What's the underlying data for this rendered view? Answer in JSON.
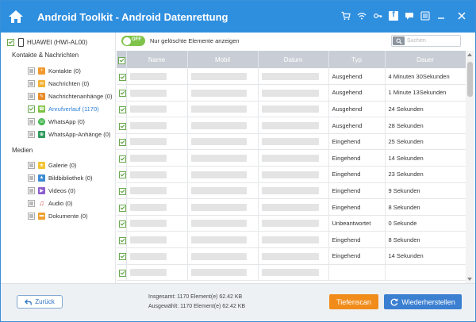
{
  "window": {
    "title": "Android Toolkit - Android Datenrettung",
    "accent_color": "#2f8fdf",
    "title_icons": [
      "cart-icon",
      "wifi-icon",
      "key-icon",
      "facebook-icon",
      "chat-icon",
      "menu-icon",
      "minimize-icon",
      "close-icon"
    ],
    "facebook_glyph": "f"
  },
  "sidebar": {
    "device": "HUAWEI (HWI-AL00)",
    "sections": [
      {
        "label": "Kontakte & Nachrichten",
        "items": [
          {
            "label": "Kontakte (0)",
            "icon": "contacts-icon",
            "color": "#f29a2e"
          },
          {
            "label": "Nachrichten (0)",
            "icon": "messages-icon",
            "color": "#f2b134"
          },
          {
            "label": "Nachrichtenanhänge (0)",
            "icon": "attachments-icon",
            "color": "#e98b2a"
          },
          {
            "label": "Anrufverlauf (1170)",
            "icon": "call-log-icon",
            "color": "#7cc242"
          },
          {
            "label": "WhatsApp (0)",
            "icon": "whatsapp-icon",
            "color": "#3fb44a"
          },
          {
            "label": "WhatsApp-Anhänge (0)",
            "icon": "whatsapp-attachments-icon",
            "color": "#2e9a5c"
          }
        ]
      },
      {
        "label": "Medien",
        "items": [
          {
            "label": "Galerie (0)",
            "icon": "gallery-icon",
            "color": "#f3c533"
          },
          {
            "label": "Bildbibliothek (0)",
            "icon": "image-library-icon",
            "color": "#3d8bd3"
          },
          {
            "label": "Videos (0)",
            "icon": "videos-icon",
            "color": "#8e5fd0"
          },
          {
            "label": "Audio (0)",
            "icon": "audio-icon",
            "color": "#d9534f"
          },
          {
            "label": "Dokumente (0)",
            "icon": "documents-icon",
            "color": "#f0a030"
          }
        ]
      }
    ]
  },
  "toolbar": {
    "toggle_label": "OFF",
    "toggle_caption": "Nur gelöschte Elemente anzeigen",
    "search_placeholder": "Suchen"
  },
  "table": {
    "columns": [
      "Name",
      "Mobil",
      "Datum",
      "Typ",
      "Dauer"
    ],
    "rows": [
      {
        "typ": "Ausgehend",
        "dauer": "4 Minuten 30Sekunden"
      },
      {
        "typ": "Ausgehend",
        "dauer": "1 Minute 13Sekunden"
      },
      {
        "typ": "Ausgehend",
        "dauer": "24 Sekunden"
      },
      {
        "typ": "Ausgehend",
        "dauer": "28 Sekunden"
      },
      {
        "typ": "Eingehend",
        "dauer": "25 Sekunden"
      },
      {
        "typ": "Eingehend",
        "dauer": "14 Sekunden"
      },
      {
        "typ": "Eingehend",
        "dauer": "23 Sekunden"
      },
      {
        "typ": "Eingehend",
        "dauer": "9 Sekunden"
      },
      {
        "typ": "Eingehend",
        "dauer": "8 Sekunden"
      },
      {
        "typ": "Unbeantwortet",
        "dauer": "0 Sekunde"
      },
      {
        "typ": "Eingehend",
        "dauer": "8 Sekunden"
      },
      {
        "typ": "Eingehend",
        "dauer": "14 Sekunden"
      },
      {
        "typ": "",
        "dauer": ""
      }
    ]
  },
  "footer": {
    "back_label": "Zurück",
    "total_text": "Insgesamt: 1170 Element(e) 62.42 KB",
    "selected_text": "Ausgewählt: 1170 Element(e) 62.42 KB",
    "scan_label": "Tiefenscan",
    "restore_label": "Wiederherstellen",
    "scan_color": "#f18c1b",
    "restore_color": "#3b7fd1"
  }
}
